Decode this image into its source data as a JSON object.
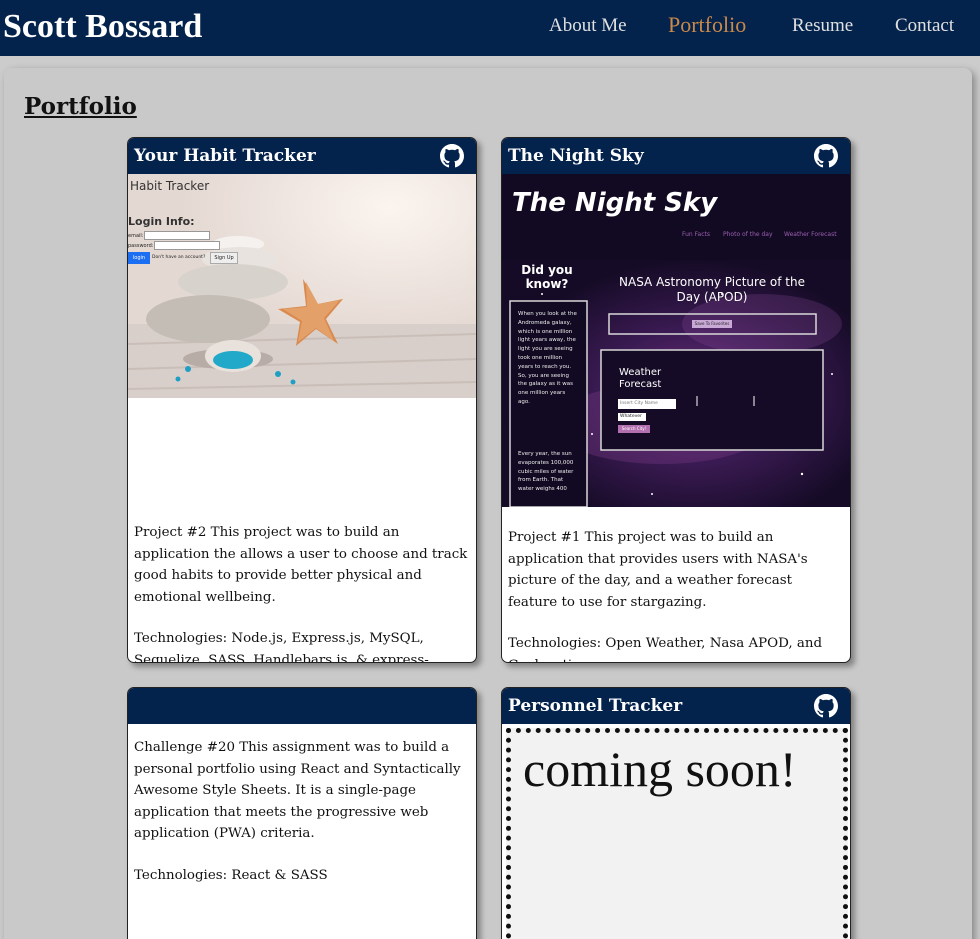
{
  "header": {
    "brand": "Scott Bossard",
    "nav": [
      {
        "label": "About Me"
      },
      {
        "label": "Portfolio"
      },
      {
        "label": "Resume"
      },
      {
        "label": "Contact"
      }
    ],
    "active_color": "#c8894a",
    "bg_color": "#03224c"
  },
  "page": {
    "title": "Portfolio"
  },
  "projects": [
    {
      "title": "Your Habit Tracker",
      "github_icon": "github-icon",
      "screenshot": {
        "app_title": "Habit Tracker",
        "login_heading": "Login Info:",
        "email_label": "email:",
        "password_label": "password:",
        "login_button": "login",
        "no_account_text": "Don't have an account?",
        "signup_button": "Sign Up"
      },
      "description": "Project #2 This project was to build an application the allows a user to choose and track good habits to provide better physical and emotional wellbeing.",
      "technologies": "Technologies: Node.js, Express.js, MySQL, Sequelize, SASS, Handlebars.js, & express-session"
    },
    {
      "title": "The Night Sky",
      "github_icon": "github-icon",
      "screenshot": {
        "app_title": "The Night Sky",
        "nav": [
          "Fun Facts",
          "Photo of the day",
          "Weather Forecast"
        ],
        "did_you_know": "Did you know?",
        "fact_1": "When you look at the Andromeda galaxy, which is one million light years away, the light you are seeing took one million years to reach you. So, you are seeing the galaxy as it was one million years ago.",
        "fact_2": "Every year, the sun evaporates 100,000 cubic miles of water from Earth. That water weighs 400",
        "apod_title": "NASA Astronomy Picture of the Day (APOD)",
        "apod_button": "Save To Favorites",
        "weather_title": "Weather Forecast",
        "city_placeholder": "Insert City Name",
        "select_value": "Whatever",
        "search_button": "Search City!"
      },
      "description": "Project #1 This project was to build an application that provides users with NASA's picture of the day, and a weather forecast feature to use for stargazing.",
      "technologies": "Technologies: Open Weather, Nasa APOD, and Geolocation"
    },
    {
      "title": "",
      "description": "Challenge #20 This assignment was to build a personal portfolio using React and Syntactically Awesome Style Sheets. It is a single-page application that meets the progressive web application (PWA) criteria.",
      "technologies": "Technologies: React & SASS"
    },
    {
      "title": "Personnel Tracker",
      "github_icon": "github-icon",
      "placeholder_text": "coming soon!"
    }
  ]
}
